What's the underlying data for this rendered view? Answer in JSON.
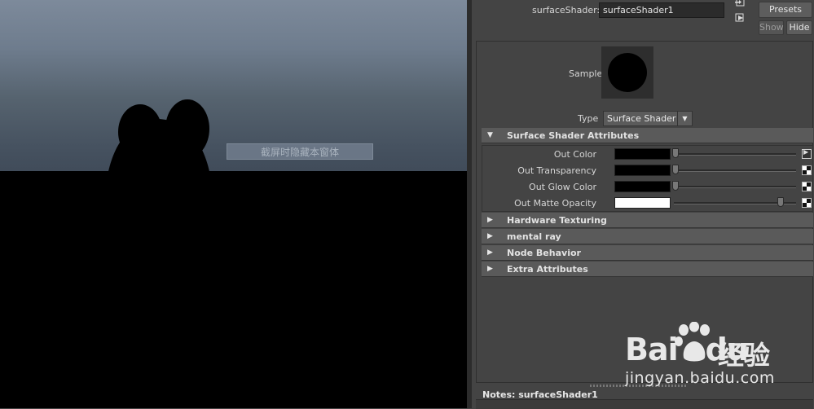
{
  "viewport": {
    "overlay_button": "截屏时隐藏本窗体"
  },
  "attribute_editor": {
    "node_label": "surfaceShader:",
    "node_name": "surfaceShader1",
    "presets_button": "Presets",
    "show_button": "Show",
    "hide_button": "Hide",
    "sample_label": "Sample",
    "type_label": "Type",
    "type_value": "Surface Shader",
    "sections": [
      {
        "title": "Surface Shader Attributes",
        "expanded": true
      },
      {
        "title": "Hardware Texturing",
        "expanded": false
      },
      {
        "title": "mental ray",
        "expanded": false
      },
      {
        "title": "Node Behavior",
        "expanded": false
      },
      {
        "title": "Extra Attributes",
        "expanded": false
      }
    ],
    "attributes": [
      {
        "label": "Out Color",
        "color": "#000000",
        "slider": 0.0,
        "map": "connected"
      },
      {
        "label": "Out Transparency",
        "color": "#000000",
        "slider": 0.0,
        "map": "checker"
      },
      {
        "label": "Out Glow Color",
        "color": "#000000",
        "slider": 0.0,
        "map": "checker"
      },
      {
        "label": "Out Matte Opacity",
        "color": "#ffffff",
        "slider": 1.0,
        "map": "checker"
      }
    ],
    "notes_label": "Notes:  surfaceShader1"
  },
  "watermark": {
    "brand": "Bai",
    "brand_suffix": "du",
    "product": "经验",
    "url": "jingyan.baidu.com"
  }
}
